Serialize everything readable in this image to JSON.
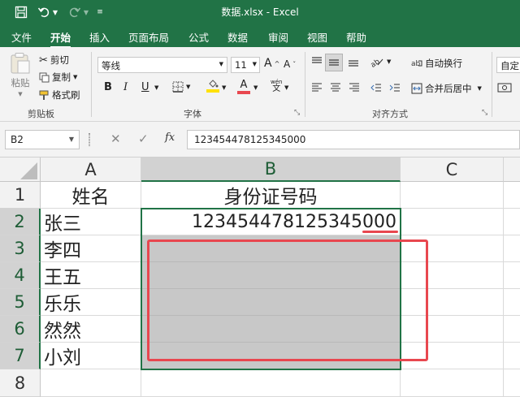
{
  "title_bar": {
    "title": "数据.xlsx  -  Excel"
  },
  "tabs": [
    "文件",
    "开始",
    "插入",
    "页面布局",
    "公式",
    "数据",
    "审阅",
    "视图",
    "帮助"
  ],
  "active_tab": "开始",
  "ribbon": {
    "clipboard": {
      "paste": "粘贴",
      "cut": "剪切",
      "copy": "复制",
      "format_painter": "格式刷",
      "label": "剪贴板"
    },
    "font": {
      "name": "等线",
      "size": "11",
      "grow": "A",
      "shrink": "A",
      "bold": "B",
      "italic": "I",
      "underline": "U",
      "font_color_letter": "A",
      "phonetic_top": "wén",
      "phonetic_bottom": "文",
      "label": "字体"
    },
    "alignment": {
      "wrap_text": "自动换行",
      "merge_center": "合并后居中",
      "label": "对齐方式"
    },
    "number": {
      "format": "自定"
    }
  },
  "formula_bar": {
    "name_box": "B2",
    "fx": "fx",
    "content": "123454478125345000"
  },
  "columns": [
    "A",
    "B",
    "C"
  ],
  "rows": [
    {
      "num": "1",
      "a": "姓名",
      "b": "身份证号码"
    },
    {
      "num": "2",
      "a": "张三",
      "b": "123454478125345000"
    },
    {
      "num": "3",
      "a": "李四",
      "b": ""
    },
    {
      "num": "4",
      "a": "王五",
      "b": ""
    },
    {
      "num": "5",
      "a": "乐乐",
      "b": ""
    },
    {
      "num": "6",
      "a": "然然",
      "b": ""
    },
    {
      "num": "7",
      "a": "小刘",
      "b": ""
    },
    {
      "num": "8",
      "a": "",
      "b": ""
    }
  ],
  "colors": {
    "excel_green": "#217346",
    "highlight_red": "#e8474f",
    "selection_gray": "#c8c8c8"
  }
}
